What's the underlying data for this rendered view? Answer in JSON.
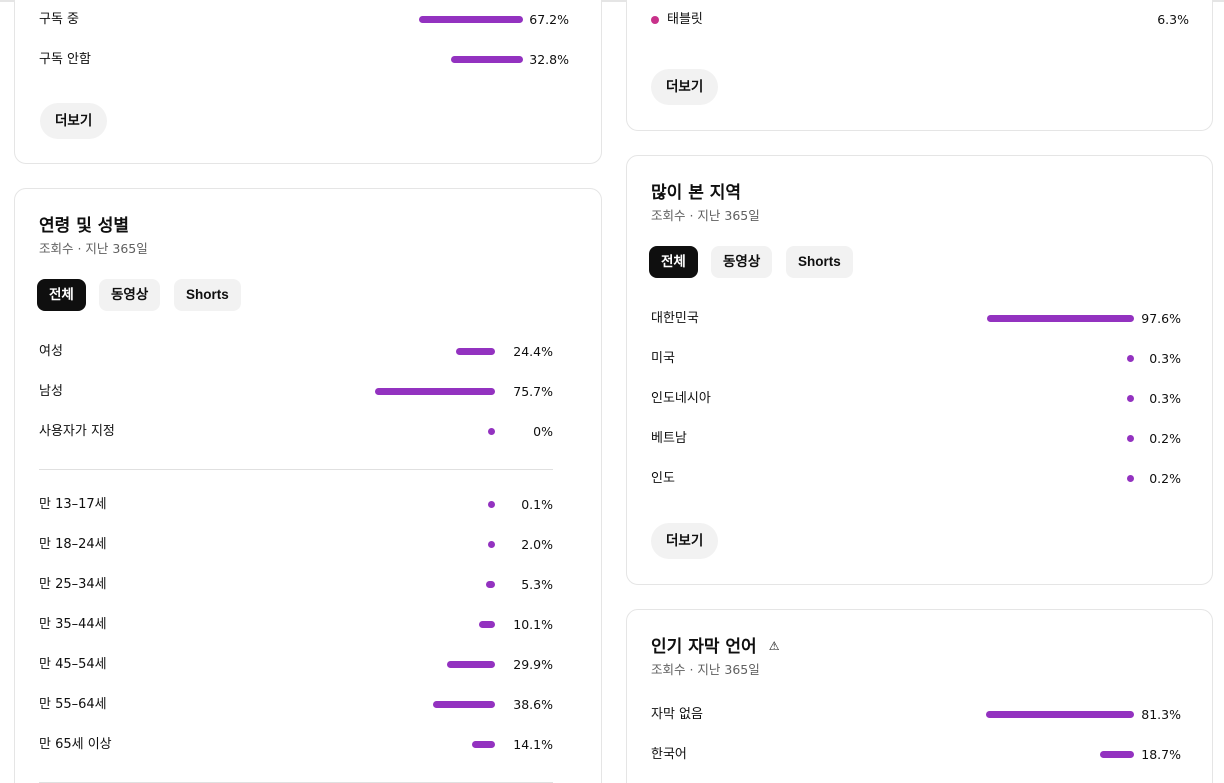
{
  "colors": {
    "bar": "#9332c0",
    "tablet_dot": "#c8318a",
    "active_tab_bg": "#0f0f0f",
    "pill_bg": "#f2f2f2"
  },
  "subscription": {
    "rows": [
      {
        "label": "구독 중",
        "value": "67.2%",
        "fraction": 0.672
      },
      {
        "label": "구독 안함",
        "value": "32.8%",
        "fraction": 0.328
      }
    ],
    "more_label": "더보기"
  },
  "device": {
    "rows": [
      {
        "label": "태블릿",
        "value": "6.3%",
        "icon": "dot-icon"
      }
    ],
    "more_label": "더보기"
  },
  "age_gender": {
    "title": "연령 및 성별",
    "subtitle": "조회수 · 지난 365일",
    "tabs": [
      {
        "label": "전체",
        "active": true
      },
      {
        "label": "동영상",
        "active": false
      },
      {
        "label": "Shorts",
        "active": false
      }
    ],
    "gender_rows": [
      {
        "label": "여성",
        "value": "24.4%",
        "fraction": 0.244
      },
      {
        "label": "남성",
        "value": "75.7%",
        "fraction": 0.757
      },
      {
        "label": "사용자가 지정",
        "value": "0%",
        "fraction": 0
      }
    ],
    "age_rows": [
      {
        "label": "만 13–17세",
        "value": "0.1%",
        "fraction": 0.001
      },
      {
        "label": "만 18–24세",
        "value": "2.0%",
        "fraction": 0.02
      },
      {
        "label": "만 25–34세",
        "value": "5.3%",
        "fraction": 0.053
      },
      {
        "label": "만 35–44세",
        "value": "10.1%",
        "fraction": 0.101
      },
      {
        "label": "만 45–54세",
        "value": "29.9%",
        "fraction": 0.299
      },
      {
        "label": "만 55–64세",
        "value": "38.6%",
        "fraction": 0.386
      },
      {
        "label": "만 65세 이상",
        "value": "14.1%",
        "fraction": 0.141
      }
    ]
  },
  "geography": {
    "title": "많이 본 지역",
    "subtitle": "조회수 · 지난 365일",
    "tabs": [
      {
        "label": "전체",
        "active": true
      },
      {
        "label": "동영상",
        "active": false
      },
      {
        "label": "Shorts",
        "active": false
      }
    ],
    "rows": [
      {
        "label": "대한민국",
        "value": "97.6%",
        "fraction": 0.976
      },
      {
        "label": "미국",
        "value": "0.3%",
        "fraction": 0.003
      },
      {
        "label": "인도네시아",
        "value": "0.3%",
        "fraction": 0.003
      },
      {
        "label": "베트남",
        "value": "0.2%",
        "fraction": 0.002
      },
      {
        "label": "인도",
        "value": "0.2%",
        "fraction": 0.002
      }
    ],
    "more_label": "더보기"
  },
  "subtitles": {
    "title": "인기 자막 언어",
    "title_icon": "warning-icon",
    "subtitle": "조회수 · 지난 365일",
    "rows": [
      {
        "label": "자막 없음",
        "value": "81.3%",
        "fraction": 0.813
      },
      {
        "label": "한국어",
        "value": "18.7%",
        "fraction": 0.187
      }
    ]
  }
}
